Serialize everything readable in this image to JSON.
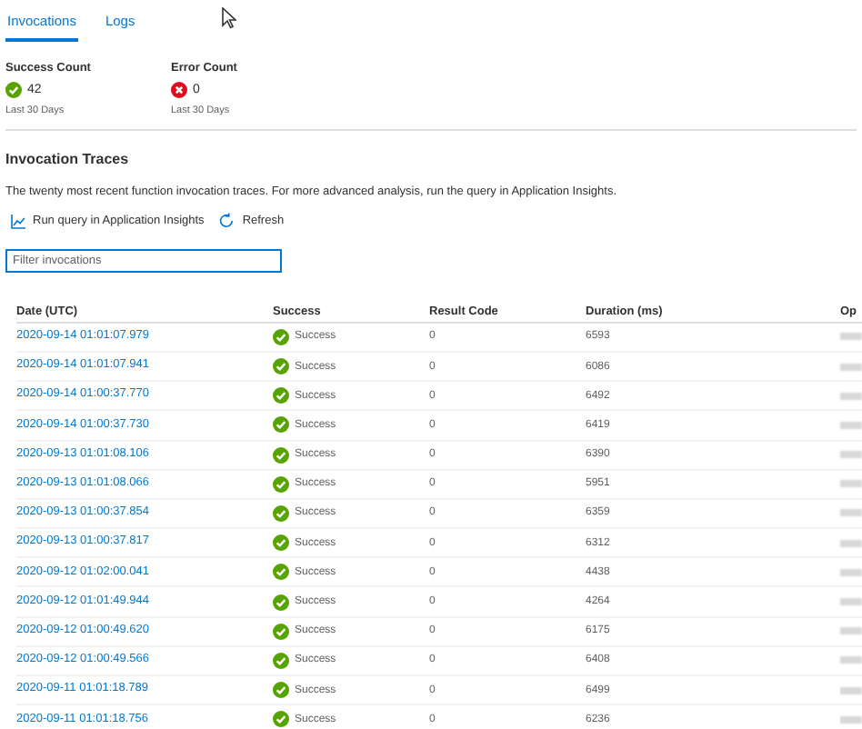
{
  "tabs": [
    {
      "label": "Invocations",
      "selected": true
    },
    {
      "label": "Logs",
      "selected": false
    }
  ],
  "summary": [
    {
      "title": "Success Count",
      "kind": "success",
      "value": "42",
      "period": "Last 30 Days"
    },
    {
      "title": "Error Count",
      "kind": "error",
      "value": "0",
      "period": "Last 30 Days"
    }
  ],
  "section_title": "Invocation Traces",
  "description": "The twenty most recent function invocation traces. For more advanced analysis, run the query in Application Insights.",
  "toolbar": [
    {
      "kind": "chart",
      "label": "Run query in Application Insights"
    },
    {
      "kind": "refresh",
      "label": "Refresh"
    }
  ],
  "filter": {
    "placeholder": "Filter invocations"
  },
  "table": {
    "columns": [
      "Date (UTC)",
      "Success",
      "Result Code",
      "Duration (ms)",
      "Op"
    ],
    "rows": [
      {
        "date": "2020-09-14 01:01:07.979",
        "success": "Success",
        "result_code": "0",
        "duration": "6593"
      },
      {
        "date": "2020-09-14 01:01:07.941",
        "success": "Success",
        "result_code": "0",
        "duration": "6086"
      },
      {
        "date": "2020-09-14 01:00:37.770",
        "success": "Success",
        "result_code": "0",
        "duration": "6492"
      },
      {
        "date": "2020-09-14 01:00:37.730",
        "success": "Success",
        "result_code": "0",
        "duration": "6419"
      },
      {
        "date": "2020-09-13 01:01:08.106",
        "success": "Success",
        "result_code": "0",
        "duration": "6390"
      },
      {
        "date": "2020-09-13 01:01:08.066",
        "success": "Success",
        "result_code": "0",
        "duration": "5951"
      },
      {
        "date": "2020-09-13 01:00:37.854",
        "success": "Success",
        "result_code": "0",
        "duration": "6359"
      },
      {
        "date": "2020-09-13 01:00:37.817",
        "success": "Success",
        "result_code": "0",
        "duration": "6312"
      },
      {
        "date": "2020-09-12 01:02:00.041",
        "success": "Success",
        "result_code": "0",
        "duration": "4438"
      },
      {
        "date": "2020-09-12 01:01:49.944",
        "success": "Success",
        "result_code": "0",
        "duration": "4264"
      },
      {
        "date": "2020-09-12 01:00:49.620",
        "success": "Success",
        "result_code": "0",
        "duration": "6175"
      },
      {
        "date": "2020-09-12 01:00:49.566",
        "success": "Success",
        "result_code": "0",
        "duration": "6408"
      },
      {
        "date": "2020-09-11 01:01:18.789",
        "success": "Success",
        "result_code": "0",
        "duration": "6499"
      },
      {
        "date": "2020-09-11 01:01:18.756",
        "success": "Success",
        "result_code": "0",
        "duration": "6236"
      }
    ]
  }
}
